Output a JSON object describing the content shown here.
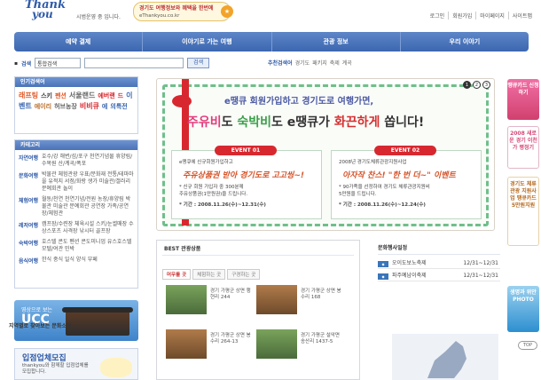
{
  "header": {
    "logo_line1": "Thank",
    "logo_line2": "you",
    "trial_text": "시범운영 중 입니다.",
    "promo_title": "경기도 여행정보와 혜택을 한번에",
    "promo_sub": "eThankyou.co.kr",
    "top_links": [
      "로그인",
      "회원가입",
      "마이페이지",
      "사이트맵"
    ]
  },
  "nav": [
    "예약 결제",
    "이야기로 가는 여행",
    "관광 정보",
    "우리 이야기"
  ],
  "search": {
    "label": "검색",
    "select_value": "통합검색",
    "input_value": "",
    "button_label": "검색",
    "rec_label": "추천검색어",
    "rec_items": [
      "경기도",
      "패키지",
      "축제",
      "계곡"
    ]
  },
  "tags": {
    "title": "인기검색어",
    "words": [
      {
        "t": "래프팅",
        "c": "#e05a2a"
      },
      {
        "t": "스키",
        "c": "#333333"
      },
      {
        "t": "펜션",
        "c": "#e05a2a"
      },
      {
        "t": "서울랜드",
        "c": "#666666"
      },
      {
        "t": "에버랜",
        "c": "#d4262d"
      },
      {
        "t": "드",
        "c": "#d4262d"
      },
      {
        "t": "이벤트",
        "c": "#3a66b0"
      },
      {
        "t": "에이리",
        "c": "#b96c2a"
      },
      {
        "t": "허브농장",
        "c": "#666666"
      },
      {
        "t": "비비큐",
        "c": "#d4262d"
      },
      {
        "t": "에",
        "c": "#3a66b0"
      },
      {
        "t": "의특전",
        "c": "#3a66b0"
      }
    ]
  },
  "categories": {
    "title": "카테고리",
    "rows": [
      {
        "label": "자연여행",
        "items": "호수/강 해변/섬/포구 천연기념물 휴양림/수목원 산/계곡/폭포"
      },
      {
        "label": "문화여행",
        "items": "박물관 체험관광 우표/문화재 전통/테마마을 유적지 서점/화랑 생가 미술관/갤러리 문예회관 놀이"
      },
      {
        "label": "체험여행",
        "items": "월동/천연 천연기념/전원 농장/휴양림 박물관 미술관 문예회관 공연장 가족/공연장/체험관"
      },
      {
        "label": "레저여행",
        "items": "캠프장/수련장 체육시설 스키/눈썰매장 수상스포츠 사격장 낚시터 골프장"
      },
      {
        "label": "숙박여행",
        "items": "호스텔 콘도 펜션 콘도미니엄 유스호스텔 모텔/여관 민박"
      },
      {
        "label": "음식여행",
        "items": "한식 중식 일식 양식 부페"
      }
    ]
  },
  "ucc": {
    "line1": "영상으로 보는",
    "line2": "UCC"
  },
  "register": {
    "title": "입점업체모집",
    "text": "thankyou와 함께할 입점업체를 모집합니다."
  },
  "banner": {
    "pager": [
      "1",
      "2",
      "3"
    ],
    "title": "e땡큐 회원가입하고 경기도로 여행가면,",
    "main_a": "주유비",
    "main_b": "도",
    "main_c": "숙박비",
    "main_d": "도 e땡큐가",
    "main_e": "화끈하게",
    "main_f": "쏩니다!",
    "event1": {
      "label": "EVENT 01",
      "line1": "e땡큐에 신규회원가입하고",
      "big": "주유상품권 받아 경기도로 고고씽~!",
      "line2": "* 신규 회원 가입자 중 300분께",
      "line3": "주유상품권(1만원권)을 드립니다.",
      "period": "* 기간 : 2008.11.26(수)~12.31(수)"
    },
    "event2": {
      "label": "EVENT 02",
      "line0": "2008년 경기도체류관광지원사업",
      "big": "아자작 찬스! \"한 번 더~\" 이벤트",
      "line2": "* 90가족을 선정하여 경기도 체류관광지원비",
      "line3": "5만원을 드립니다.",
      "period": "* 기간 : 2008.11.26(수)~12.24(수)"
    }
  },
  "right_banners": {
    "b1": "땡큐카드 신청하기",
    "b2": "2008 새로운 경기 이천가 평정기",
    "b3": "경기도 체류관광 지원사업 땡큐카드 5만원지원",
    "b4": "생명과 위안 PHOTO",
    "top": "TOP"
  },
  "best": {
    "title": "BEST 관광상품",
    "tabs": [
      "머무를 곳",
      "체험하는 곳",
      "구경하는 곳"
    ],
    "items": [
      "경기 가평군 상면 행현리 244",
      "경기 가평군 상면 봉수리 168",
      "경기 가평군 상면 봉수리 264-13",
      "경기 가평군 설악면 송산리 1437-5"
    ]
  },
  "schedule": {
    "title": "문화행사일정",
    "rows": [
      {
        "name": "오이도보노축제",
        "date": "12/31~12/31"
      },
      {
        "name": "파주예남이축제",
        "date": "12/31~12/31"
      }
    ]
  },
  "map": {
    "title": "지역별로 찾아보는 문화소식"
  }
}
